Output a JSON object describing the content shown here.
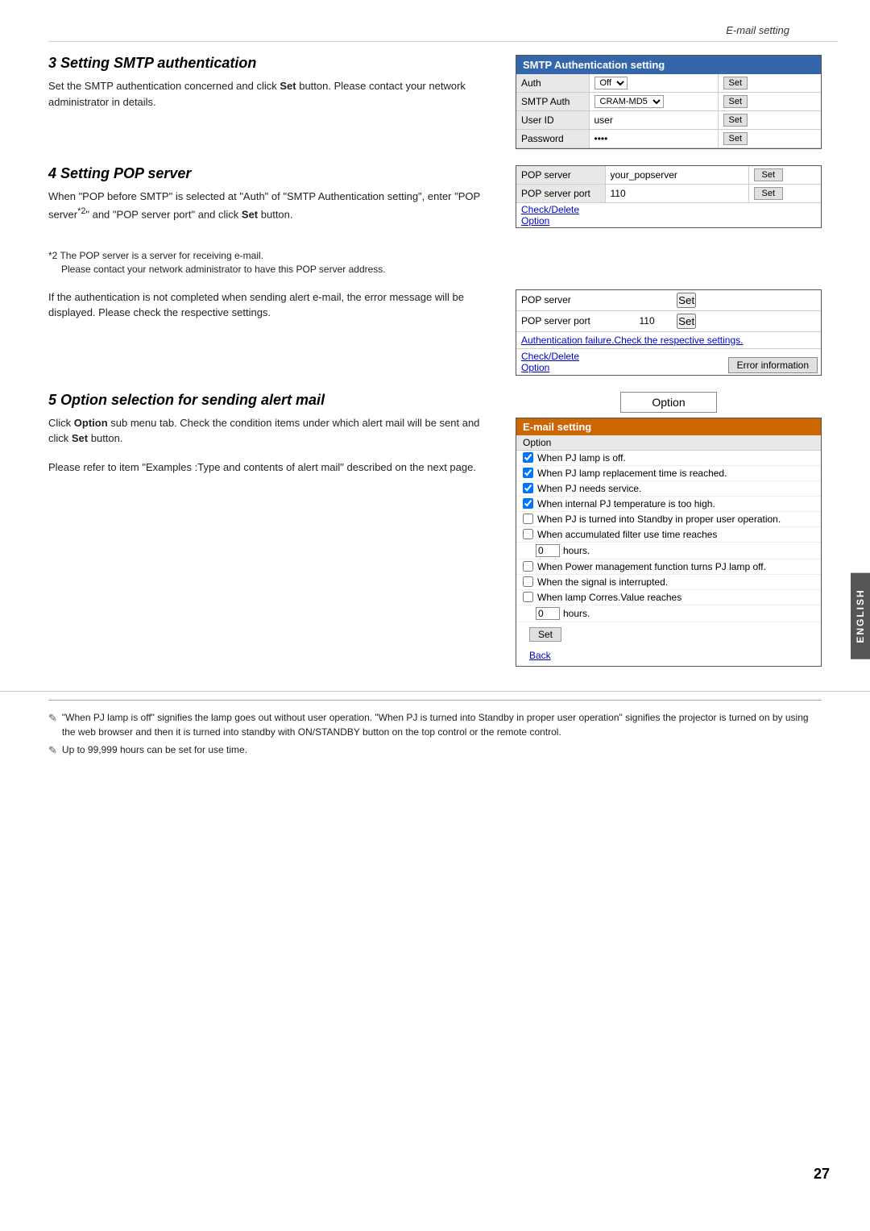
{
  "page": {
    "title": "E-mail setting",
    "page_number": "27",
    "english_label": "ENGLISH"
  },
  "section3": {
    "title": "3  Setting SMTP authentication",
    "body": "Set the SMTP authentication concerned and click Set button. Please contact your network administrator in details.",
    "bold_word": "Set",
    "smtp_table": {
      "header": "SMTP Authentication setting",
      "rows": [
        {
          "label": "Auth",
          "value": "Off",
          "has_dropdown": true,
          "set_btn": "Set"
        },
        {
          "label": "SMTP Auth",
          "value": "CRAM-MD5",
          "has_dropdown": true,
          "set_btn": "Set"
        },
        {
          "label": "User ID",
          "value": "user",
          "has_dropdown": false,
          "set_btn": "Set"
        },
        {
          "label": "Password",
          "value": "••••",
          "has_dropdown": false,
          "set_btn": "Set"
        }
      ]
    }
  },
  "section4": {
    "title": "4  Setting POP server",
    "body_parts": [
      "When \"POP before SMTP\" is selected at \"Auth\" of \"SMTP Authentication setting\", enter \"POP server",
      "*2",
      "\" and \"POP server port\" and click ",
      "Set",
      " button."
    ],
    "pop_table": {
      "rows": [
        {
          "label": "POP server",
          "value": "your_popserver",
          "set_btn": "Set"
        },
        {
          "label": "POP server port",
          "value": "110",
          "set_btn": "Set"
        }
      ],
      "link1": "Check/Delete",
      "link2": "Option"
    },
    "footnote": {
      "marker": "*2",
      "text": "The POP server is a server for receiving e-mail.",
      "subtext": "Please contact your network administrator to have this POP server address."
    }
  },
  "section4b": {
    "body": "If the authentication is not completed when sending alert e-mail, the error message will be displayed. Please check the respective settings.",
    "error_table": {
      "rows": [
        {
          "label": "POP server",
          "value": "",
          "set_btn": "Set"
        },
        {
          "label": "POP server port",
          "value": "110",
          "set_btn": "Set"
        }
      ],
      "auth_failure_text": "Authentication failure.Check the respective settings.",
      "link1": "Check/Delete",
      "link2": "Option",
      "error_info_btn": "Error information"
    }
  },
  "section5": {
    "title": "5  Option selection for sending alert mail",
    "body_part1": "Click ",
    "bold_option": "Option",
    "body_part2": " sub menu tab. Check the condition items under which alert mail will be sent and click ",
    "bold_set": "Set",
    "body_part3": " button.",
    "body2": "Please refer to item \"Examples :Type and contents of alert mail\" described on the next page.",
    "option_dialog": {
      "title": "Option",
      "panel_header": "E-mail setting",
      "panel_subheader": "Option",
      "items": [
        {
          "text": "When PJ lamp is off.",
          "checked": true,
          "is_hours": false
        },
        {
          "text": "When PJ lamp replacement time is reached.",
          "checked": true,
          "is_hours": false
        },
        {
          "text": "When PJ needs service.",
          "checked": true,
          "is_hours": false
        },
        {
          "text": "When internal PJ temperature is too high.",
          "checked": true,
          "is_hours": false
        },
        {
          "text": "When PJ is turned into Standby in proper user operation.",
          "checked": false,
          "is_hours": false
        },
        {
          "text": "When accumulated filter use time reaches",
          "checked": false,
          "is_hours": false
        },
        {
          "hours_value": "0",
          "hours_label": "hours.",
          "is_hours": true
        },
        {
          "text": "When Power management function turns PJ lamp off.",
          "checked": false,
          "is_hours": false
        },
        {
          "text": "When the signal is interrupted.",
          "checked": false,
          "is_hours": false
        },
        {
          "text": "When lamp Corres.Value reaches",
          "checked": false,
          "is_hours": false
        },
        {
          "hours_value": "0",
          "hours_label": "hours.",
          "is_hours": true
        }
      ],
      "set_btn": "Set",
      "back_link": "Back"
    }
  },
  "footnotes": [
    {
      "icon": "✎",
      "text": "\"When PJ lamp is off\" signifies the lamp goes out without user operation. \"When PJ is turned into Standby in proper user operation\" signifies the projector is turned on by using the web browser and then it is turned into standby with ON/STANDBY button on the top control or the remote control."
    },
    {
      "icon": "✎",
      "text": "Up to 99,999 hours can be set for use time."
    }
  ]
}
